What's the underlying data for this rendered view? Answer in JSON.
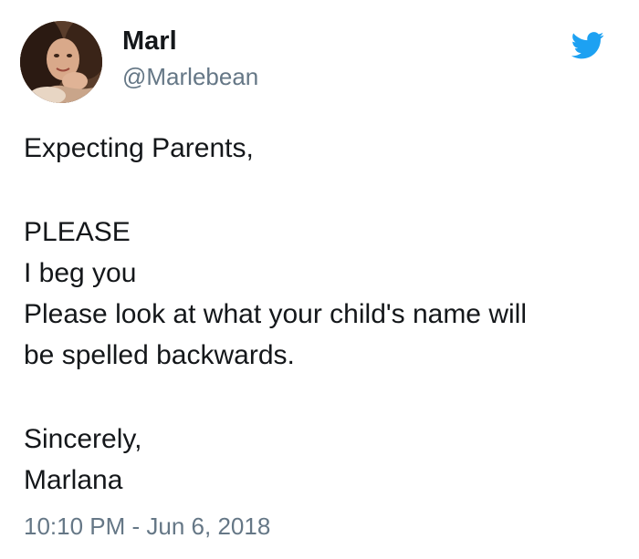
{
  "author": {
    "display_name": "Marl",
    "handle": "@Marlebean"
  },
  "tweet": {
    "greeting": "Expecting Parents,",
    "line_please": "PLEASE",
    "line_beg": "I beg you",
    "line_request_1": "Please look at what your child's name will",
    "line_request_2": "be spelled backwards.",
    "sign_off": "Sincerely,",
    "signature": "Marlana"
  },
  "timestamp": "10:10 PM - Jun 6, 2018",
  "icons": {
    "brand": "twitter-bird-icon",
    "avatar": "profile-photo"
  },
  "colors": {
    "text_primary": "#14171a",
    "text_secondary": "#657786",
    "twitter_blue": "#1da1f2",
    "background": "#ffffff"
  }
}
